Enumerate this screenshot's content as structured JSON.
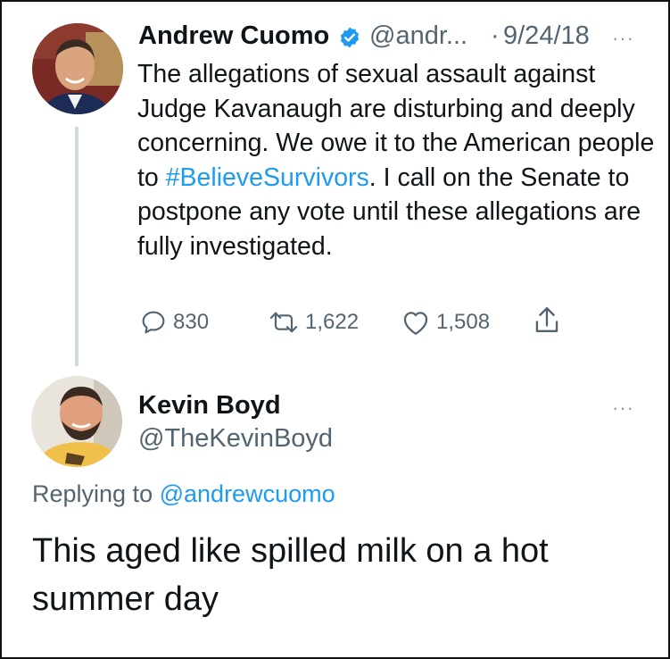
{
  "tweet": {
    "author_name": "Andrew Cuomo",
    "handle": "@andr...",
    "separator": "·",
    "date": "9/24/18",
    "more": "···",
    "text_before": "The allegations of sexual assault against Judge Kavanaugh are disturbing and deeply concerning. We owe it to the American people to ",
    "hashtag": "#BelieveSurvivors",
    "text_after": ". I call on the Senate to postpone any vote until these allegations are fully investigated.",
    "reply_count": "830",
    "retweet_count": "1,622",
    "like_count": "1,508",
    "icons": [
      "verified-badge-icon",
      "reply-icon",
      "retweet-icon",
      "like-icon",
      "share-icon"
    ],
    "colors": {
      "accent": "#1d9bf0",
      "secondary_text": "#536471"
    }
  },
  "reply": {
    "author_name": "Kevin Boyd",
    "handle": "@TheKevinBoyd",
    "more": "···",
    "replying_label": "Replying to",
    "replying_handle": "@andrewcuomo",
    "text": "This aged like spilled milk on a hot summer day"
  }
}
